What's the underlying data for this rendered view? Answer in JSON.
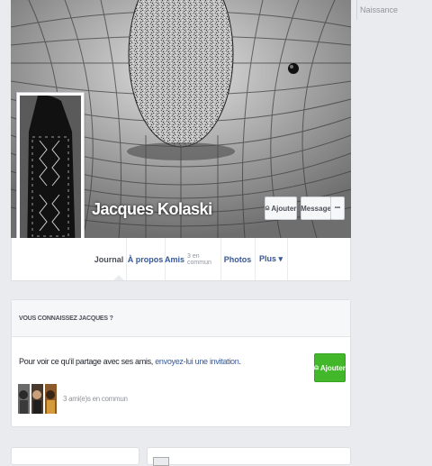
{
  "sidebar": {
    "naissance_label": "Naissance"
  },
  "profile": {
    "name": "Jacques Kolaski",
    "add_friend_label": "Ajouter",
    "message_label": "Message",
    "more_label": "•••"
  },
  "nav": {
    "tabs": [
      {
        "label": "Journal",
        "active": true
      },
      {
        "label": "À propos"
      },
      {
        "label": "Amis",
        "sub": "3 en commun"
      },
      {
        "label": "Photos"
      },
      {
        "label": "Plus ▾"
      }
    ]
  },
  "know_card": {
    "heading": "VOUS CONNAISSEZ JACQUES ?",
    "text_before": "Pour voir ce qu'il partage avec ses amis, ",
    "link_text": "envoyez-lui une invitation",
    "text_after": ".",
    "add_button": "Ajouter",
    "mutual_friends": "3 ami(e)s en commun"
  },
  "colors": {
    "accent": "#365899",
    "green": "#42b72a",
    "background": "#e9ebee"
  }
}
